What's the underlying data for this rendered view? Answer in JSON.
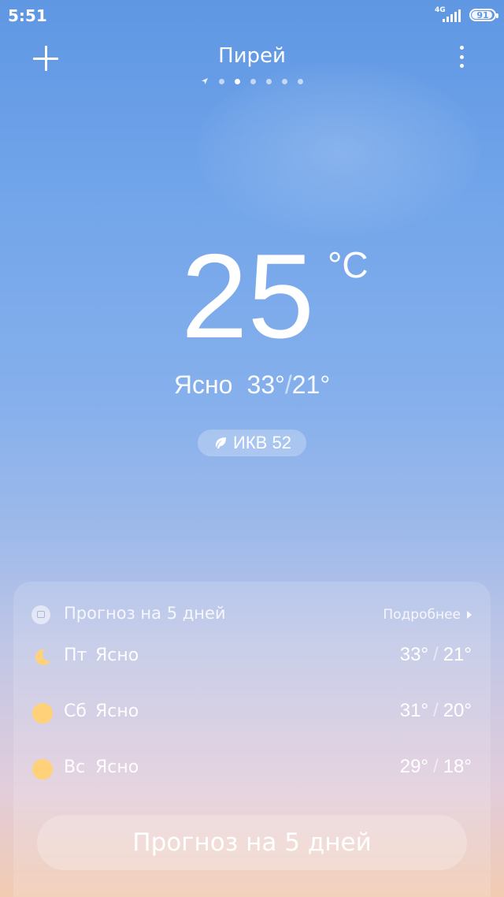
{
  "status_bar": {
    "time": "5:51",
    "network": "4G",
    "battery": "91",
    "battery_level": 0.91
  },
  "header": {
    "city": "Пирей",
    "page_count": 6,
    "active_page": 2
  },
  "current": {
    "temperature": "25",
    "unit": "°C",
    "condition": "Ясно",
    "high": "33°",
    "low": "21°",
    "aqi_label": "ИКВ 52"
  },
  "forecast": {
    "title": "Прогноз на 5 дней",
    "more_label": "Подробнее",
    "days": [
      {
        "day": "Пт",
        "condition": "Ясно",
        "high": "33°",
        "low": "21°",
        "icon": "moon-icon"
      },
      {
        "day": "Сб",
        "condition": "Ясно",
        "high": "31°",
        "low": "20°",
        "icon": "sun-icon"
      },
      {
        "day": "Вс",
        "condition": "Ясно",
        "high": "29°",
        "low": "18°",
        "icon": "sun-icon"
      }
    ],
    "button_label": "Прогноз на 5 дней"
  },
  "colors": {
    "sky_top": "#5f97e3",
    "sky_bottom": "#f2cbb2",
    "sun": "#ffd27a"
  }
}
